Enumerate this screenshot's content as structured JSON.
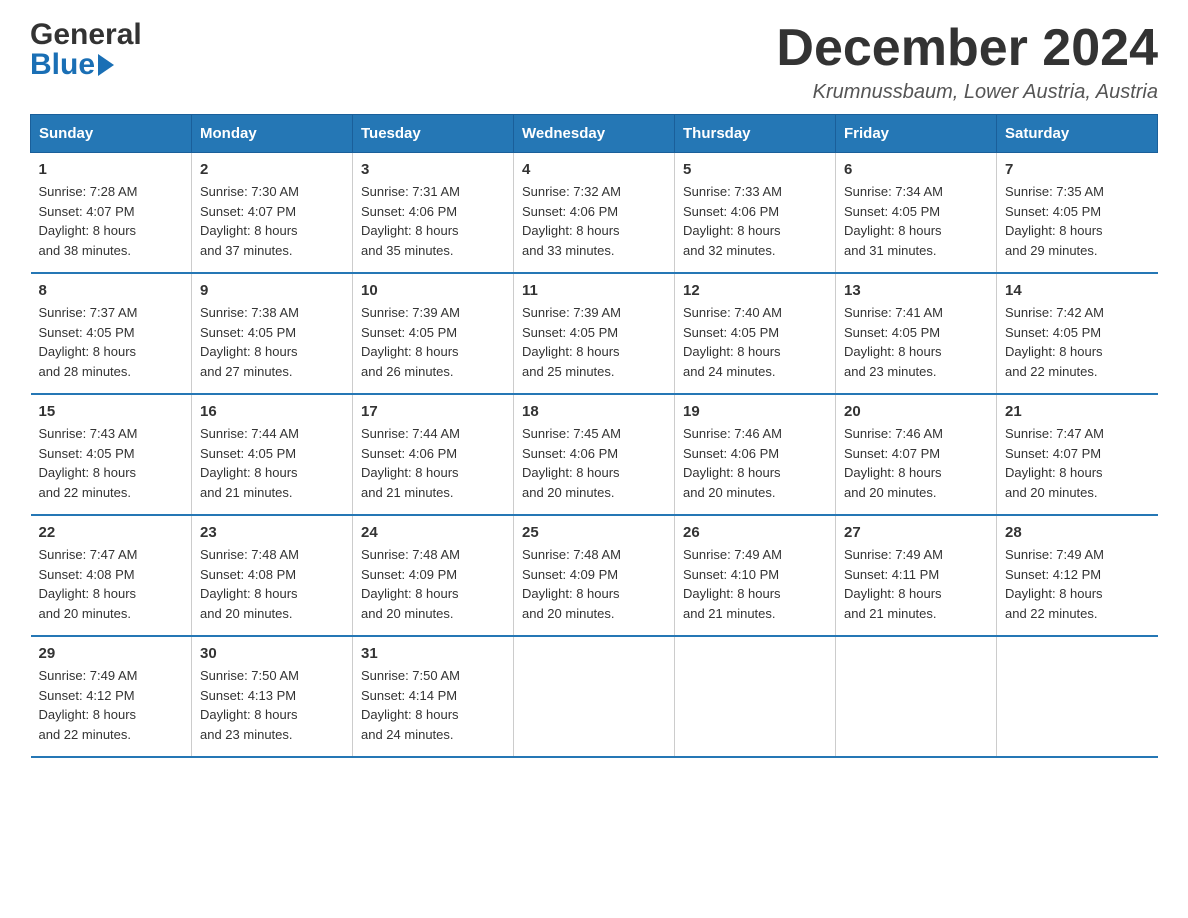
{
  "header": {
    "logo_general": "General",
    "logo_blue": "Blue",
    "title": "December 2024",
    "location": "Krumnussbaum, Lower Austria, Austria"
  },
  "columns": [
    "Sunday",
    "Monday",
    "Tuesday",
    "Wednesday",
    "Thursday",
    "Friday",
    "Saturday"
  ],
  "weeks": [
    [
      {
        "day": "1",
        "sunrise": "Sunrise: 7:28 AM",
        "sunset": "Sunset: 4:07 PM",
        "daylight": "Daylight: 8 hours",
        "daylight2": "and 38 minutes."
      },
      {
        "day": "2",
        "sunrise": "Sunrise: 7:30 AM",
        "sunset": "Sunset: 4:07 PM",
        "daylight": "Daylight: 8 hours",
        "daylight2": "and 37 minutes."
      },
      {
        "day": "3",
        "sunrise": "Sunrise: 7:31 AM",
        "sunset": "Sunset: 4:06 PM",
        "daylight": "Daylight: 8 hours",
        "daylight2": "and 35 minutes."
      },
      {
        "day": "4",
        "sunrise": "Sunrise: 7:32 AM",
        "sunset": "Sunset: 4:06 PM",
        "daylight": "Daylight: 8 hours",
        "daylight2": "and 33 minutes."
      },
      {
        "day": "5",
        "sunrise": "Sunrise: 7:33 AM",
        "sunset": "Sunset: 4:06 PM",
        "daylight": "Daylight: 8 hours",
        "daylight2": "and 32 minutes."
      },
      {
        "day": "6",
        "sunrise": "Sunrise: 7:34 AM",
        "sunset": "Sunset: 4:05 PM",
        "daylight": "Daylight: 8 hours",
        "daylight2": "and 31 minutes."
      },
      {
        "day": "7",
        "sunrise": "Sunrise: 7:35 AM",
        "sunset": "Sunset: 4:05 PM",
        "daylight": "Daylight: 8 hours",
        "daylight2": "and 29 minutes."
      }
    ],
    [
      {
        "day": "8",
        "sunrise": "Sunrise: 7:37 AM",
        "sunset": "Sunset: 4:05 PM",
        "daylight": "Daylight: 8 hours",
        "daylight2": "and 28 minutes."
      },
      {
        "day": "9",
        "sunrise": "Sunrise: 7:38 AM",
        "sunset": "Sunset: 4:05 PM",
        "daylight": "Daylight: 8 hours",
        "daylight2": "and 27 minutes."
      },
      {
        "day": "10",
        "sunrise": "Sunrise: 7:39 AM",
        "sunset": "Sunset: 4:05 PM",
        "daylight": "Daylight: 8 hours",
        "daylight2": "and 26 minutes."
      },
      {
        "day": "11",
        "sunrise": "Sunrise: 7:39 AM",
        "sunset": "Sunset: 4:05 PM",
        "daylight": "Daylight: 8 hours",
        "daylight2": "and 25 minutes."
      },
      {
        "day": "12",
        "sunrise": "Sunrise: 7:40 AM",
        "sunset": "Sunset: 4:05 PM",
        "daylight": "Daylight: 8 hours",
        "daylight2": "and 24 minutes."
      },
      {
        "day": "13",
        "sunrise": "Sunrise: 7:41 AM",
        "sunset": "Sunset: 4:05 PM",
        "daylight": "Daylight: 8 hours",
        "daylight2": "and 23 minutes."
      },
      {
        "day": "14",
        "sunrise": "Sunrise: 7:42 AM",
        "sunset": "Sunset: 4:05 PM",
        "daylight": "Daylight: 8 hours",
        "daylight2": "and 22 minutes."
      }
    ],
    [
      {
        "day": "15",
        "sunrise": "Sunrise: 7:43 AM",
        "sunset": "Sunset: 4:05 PM",
        "daylight": "Daylight: 8 hours",
        "daylight2": "and 22 minutes."
      },
      {
        "day": "16",
        "sunrise": "Sunrise: 7:44 AM",
        "sunset": "Sunset: 4:05 PM",
        "daylight": "Daylight: 8 hours",
        "daylight2": "and 21 minutes."
      },
      {
        "day": "17",
        "sunrise": "Sunrise: 7:44 AM",
        "sunset": "Sunset: 4:06 PM",
        "daylight": "Daylight: 8 hours",
        "daylight2": "and 21 minutes."
      },
      {
        "day": "18",
        "sunrise": "Sunrise: 7:45 AM",
        "sunset": "Sunset: 4:06 PM",
        "daylight": "Daylight: 8 hours",
        "daylight2": "and 20 minutes."
      },
      {
        "day": "19",
        "sunrise": "Sunrise: 7:46 AM",
        "sunset": "Sunset: 4:06 PM",
        "daylight": "Daylight: 8 hours",
        "daylight2": "and 20 minutes."
      },
      {
        "day": "20",
        "sunrise": "Sunrise: 7:46 AM",
        "sunset": "Sunset: 4:07 PM",
        "daylight": "Daylight: 8 hours",
        "daylight2": "and 20 minutes."
      },
      {
        "day": "21",
        "sunrise": "Sunrise: 7:47 AM",
        "sunset": "Sunset: 4:07 PM",
        "daylight": "Daylight: 8 hours",
        "daylight2": "and 20 minutes."
      }
    ],
    [
      {
        "day": "22",
        "sunrise": "Sunrise: 7:47 AM",
        "sunset": "Sunset: 4:08 PM",
        "daylight": "Daylight: 8 hours",
        "daylight2": "and 20 minutes."
      },
      {
        "day": "23",
        "sunrise": "Sunrise: 7:48 AM",
        "sunset": "Sunset: 4:08 PM",
        "daylight": "Daylight: 8 hours",
        "daylight2": "and 20 minutes."
      },
      {
        "day": "24",
        "sunrise": "Sunrise: 7:48 AM",
        "sunset": "Sunset: 4:09 PM",
        "daylight": "Daylight: 8 hours",
        "daylight2": "and 20 minutes."
      },
      {
        "day": "25",
        "sunrise": "Sunrise: 7:48 AM",
        "sunset": "Sunset: 4:09 PM",
        "daylight": "Daylight: 8 hours",
        "daylight2": "and 20 minutes."
      },
      {
        "day": "26",
        "sunrise": "Sunrise: 7:49 AM",
        "sunset": "Sunset: 4:10 PM",
        "daylight": "Daylight: 8 hours",
        "daylight2": "and 21 minutes."
      },
      {
        "day": "27",
        "sunrise": "Sunrise: 7:49 AM",
        "sunset": "Sunset: 4:11 PM",
        "daylight": "Daylight: 8 hours",
        "daylight2": "and 21 minutes."
      },
      {
        "day": "28",
        "sunrise": "Sunrise: 7:49 AM",
        "sunset": "Sunset: 4:12 PM",
        "daylight": "Daylight: 8 hours",
        "daylight2": "and 22 minutes."
      }
    ],
    [
      {
        "day": "29",
        "sunrise": "Sunrise: 7:49 AM",
        "sunset": "Sunset: 4:12 PM",
        "daylight": "Daylight: 8 hours",
        "daylight2": "and 22 minutes."
      },
      {
        "day": "30",
        "sunrise": "Sunrise: 7:50 AM",
        "sunset": "Sunset: 4:13 PM",
        "daylight": "Daylight: 8 hours",
        "daylight2": "and 23 minutes."
      },
      {
        "day": "31",
        "sunrise": "Sunrise: 7:50 AM",
        "sunset": "Sunset: 4:14 PM",
        "daylight": "Daylight: 8 hours",
        "daylight2": "and 24 minutes."
      },
      null,
      null,
      null,
      null
    ]
  ]
}
